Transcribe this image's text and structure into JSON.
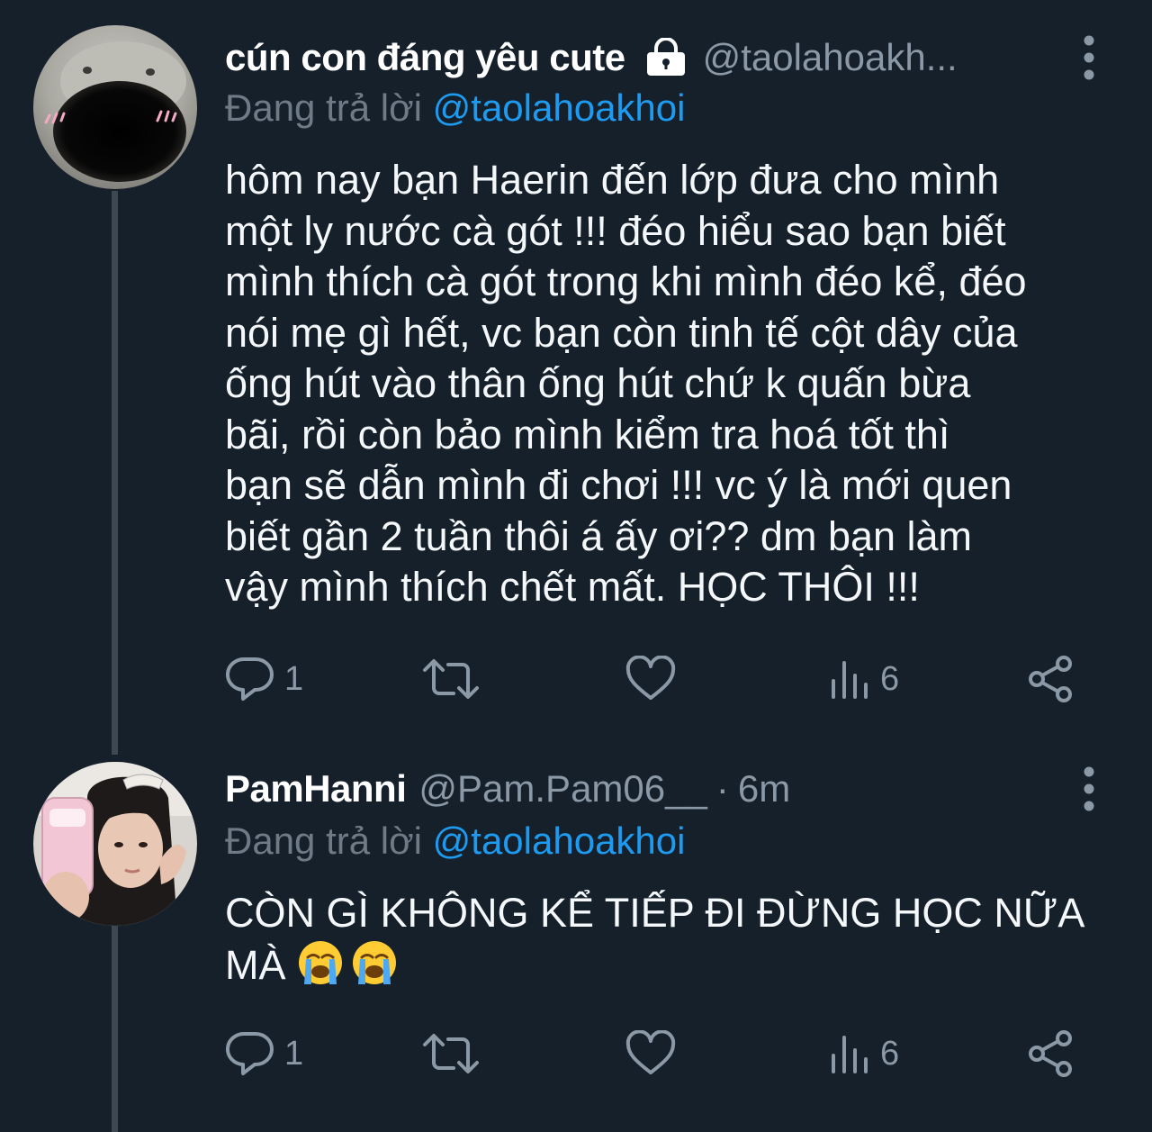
{
  "colors": {
    "background": "#15202b",
    "text": "#f5f8fa",
    "secondary_text": "#8b98a5",
    "mention": "#1d9bf0",
    "thread_line": "#3d4853"
  },
  "tweets": [
    {
      "display_name": "cún con đáng yêu cute",
      "protected_icon": "lock-icon",
      "handle": "@taolahoakh...",
      "time": "",
      "reply_prefix": "Đang trả lời",
      "reply_to": "@taolahoakhoi",
      "text": "hôm nay bạn Haerin đến lớp đưa cho mình\nmột ly nước cà gót !!! đéo hiểu sao bạn biết\nmình thích cà gót trong khi mình đéo kể, đéo\nnói mẹ gì hết, vc bạn còn tinh tế cột dây của\nống hút vào thân ống hút chứ k quấn bừa\nbãi, rồi còn bảo mình kiểm tra hoá tốt thì\nbạn sẽ dẫn mình đi chơi !!! vc ý là mới quen\nbiết gần 2 tuần thôi á ấy ơi?? dm bạn làm\nvậy mình thích chết mất. HỌC THÔI !!!",
      "emojis": [],
      "actions": {
        "replies": "1",
        "retweets": "",
        "likes": "",
        "views": "6"
      }
    },
    {
      "display_name": "PamHanni",
      "protected_icon": "",
      "handle": "@Pam.Pam06__",
      "time": "6m",
      "time_separator": "·",
      "reply_prefix": "Đang trả lời",
      "reply_to": "@taolahoakhoi",
      "text": "CÒN GÌ KHÔNG KỂ TIẾP ĐI ĐỪNG HỌC NỮA\nMÀ ",
      "emojis": [
        "loudly-crying-face-emoji",
        "loudly-crying-face-emoji"
      ],
      "actions": {
        "replies": "1",
        "retweets": "",
        "likes": "",
        "views": "6"
      }
    }
  ]
}
